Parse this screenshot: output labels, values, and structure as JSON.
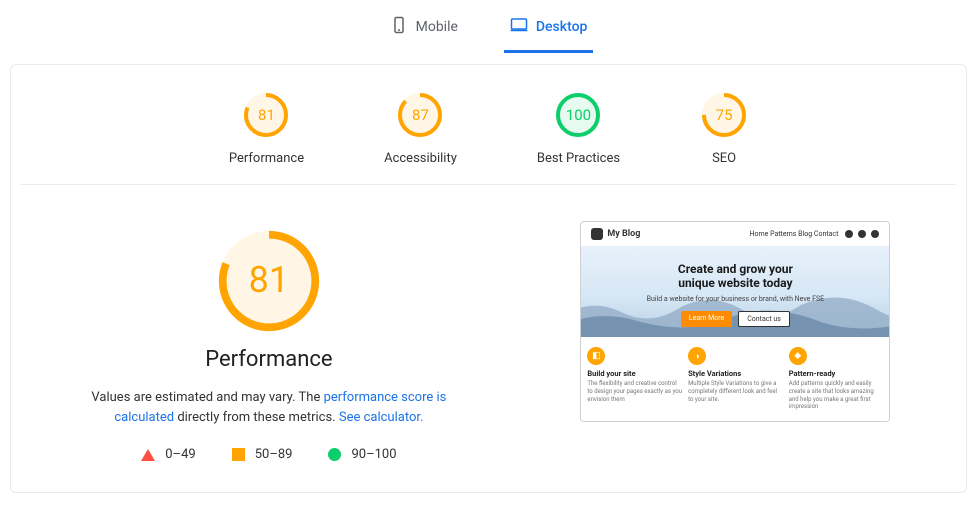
{
  "tabs": {
    "mobile": "Mobile",
    "desktop": "Desktop"
  },
  "colors": {
    "good": "#0cce6b",
    "avg": "#ffa400",
    "bad": "#ff4e42",
    "good_bg": "#e6faef",
    "avg_bg": "#fff6e6"
  },
  "scores": [
    {
      "label": "Performance",
      "value": 81,
      "status": "avg"
    },
    {
      "label": "Accessibility",
      "value": 87,
      "status": "avg"
    },
    {
      "label": "Best Practices",
      "value": 100,
      "status": "good"
    },
    {
      "label": "SEO",
      "value": 75,
      "status": "avg"
    }
  ],
  "performance": {
    "score": 81,
    "status": "avg",
    "title": "Performance",
    "desc_prefix": "Values are estimated and may vary. The ",
    "desc_link1": "performance score is calculated",
    "desc_mid": " directly from these metrics. ",
    "desc_link2": "See calculator.",
    "legend": {
      "bad": "0–49",
      "avg": "50–89",
      "good": "90–100"
    }
  },
  "preview": {
    "site_name": "My Blog",
    "nav": [
      "Home",
      "Patterns",
      "Blog",
      "Contact"
    ],
    "hero_title_l1": "Create and grow your",
    "hero_title_l2": "unique website today",
    "hero_sub": "Build a website for your business or brand, with Neve FSE",
    "btn_primary": "Learn More",
    "btn_secondary": "Contact us",
    "features": [
      {
        "title": "Build your site",
        "desc": "The flexibility and creative control to design your pages exactly as you envision them"
      },
      {
        "title": "Style Variations",
        "desc": "Multiple Style Variations to give a completely different look and feel to your site."
      },
      {
        "title": "Pattern-ready",
        "desc": "Add patterns quickly and easily create a site that looks amazing and help you make a great first impression"
      }
    ]
  }
}
